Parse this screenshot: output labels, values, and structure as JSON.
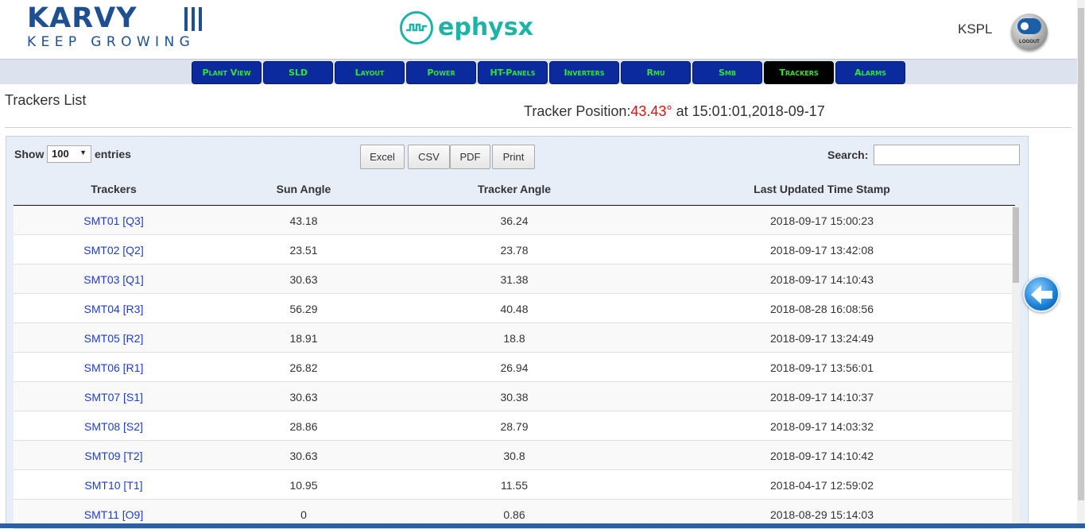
{
  "header": {
    "brand_name": "KARVY",
    "brand_tagline": "KEEP GROWING",
    "partner_name": "ephysx",
    "user_name": "KSPL",
    "logout_label": "LOGOUT"
  },
  "nav": {
    "items": [
      {
        "label": "Plant View"
      },
      {
        "label": "SLD"
      },
      {
        "label": "Layout"
      },
      {
        "label": "Power"
      },
      {
        "label": "HT-Panels"
      },
      {
        "label": "Inverters"
      },
      {
        "label": "Rmu"
      },
      {
        "label": "Smb"
      },
      {
        "label": "Trackers"
      },
      {
        "label": "Alarms"
      }
    ],
    "active": "Trackers"
  },
  "page": {
    "title": "Trackers List",
    "position_label": "Tracker Position:",
    "position_value": "43.43°",
    "position_time": " at 15:01:01,2018-09-17"
  },
  "controls": {
    "show_label": "Show",
    "page_size": "100",
    "entries_label": "entries",
    "search_label": "Search:",
    "search_value": "",
    "export_buttons": [
      "Excel",
      "CSV",
      "PDF",
      "Print"
    ]
  },
  "table": {
    "columns": [
      "Trackers",
      "Sun Angle",
      "Tracker Angle",
      "Last Updated Time Stamp"
    ],
    "rows": [
      [
        "SMT01 [Q3]",
        "43.18",
        "36.24",
        "2018-09-17 15:00:23"
      ],
      [
        "SMT02 [Q2]",
        "23.51",
        "23.78",
        "2018-09-17 13:42:08"
      ],
      [
        "SMT03 [Q1]",
        "30.63",
        "31.38",
        "2018-09-17 14:10:43"
      ],
      [
        "SMT04 [R3]",
        "56.29",
        "40.48",
        "2018-08-28 16:08:56"
      ],
      [
        "SMT05 [R2]",
        "18.91",
        "18.8",
        "2018-09-17 13:24:49"
      ],
      [
        "SMT06 [R1]",
        "26.82",
        "26.94",
        "2018-09-17 13:56:01"
      ],
      [
        "SMT07 [S1]",
        "30.63",
        "30.38",
        "2018-09-17 14:10:37"
      ],
      [
        "SMT08 [S2]",
        "28.86",
        "28.79",
        "2018-09-17 14:03:32"
      ],
      [
        "SMT09 [T2]",
        "30.63",
        "30.8",
        "2018-09-17 14:10:42"
      ],
      [
        "SMT10 [T1]",
        "10.95",
        "11.55",
        "2018-04-17 12:59:02"
      ],
      [
        "SMT11 [O9]",
        "0",
        "0.86",
        "2018-08-29 15:14:03"
      ]
    ]
  },
  "colors": {
    "brand_blue": "#1d4f91",
    "ephysx_teal": "#1fb3a6",
    "nav_bg": "#0b2a9e",
    "nav_text": "#2ee82e",
    "highlight_red": "#e01010",
    "link_blue": "#1f3ccf"
  },
  "icons": {
    "logout": "logout-icon",
    "back": "back-arrow-icon",
    "dropdown": "chevron-down-icon"
  }
}
